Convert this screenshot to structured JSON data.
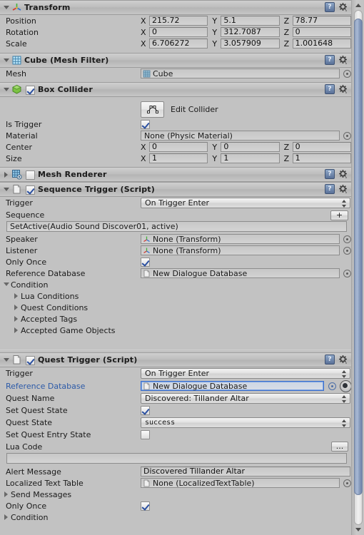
{
  "components": [
    {
      "id": "transform",
      "title": "Transform",
      "icon": "transform-axis-icon",
      "expanded": true,
      "has_enable_checkbox": false,
      "vectors": [
        {
          "label": "Position",
          "x": "215.72",
          "y": "5.1",
          "z": "78.77"
        },
        {
          "label": "Rotation",
          "x": "0",
          "y": "312.7087",
          "z": "0"
        },
        {
          "label": "Scale",
          "x": "6.706272",
          "y": "3.057909",
          "z": "1.001648"
        }
      ]
    },
    {
      "id": "mesh-filter",
      "title": "Cube (Mesh Filter)",
      "icon": "mesh-filter-icon",
      "expanded": true,
      "has_enable_checkbox": false,
      "mesh_label": "Mesh",
      "mesh_value": "Cube"
    },
    {
      "id": "box-collider",
      "title": "Box Collider",
      "icon": "box-collider-icon",
      "expanded": true,
      "has_enable_checkbox": true,
      "enabled": true,
      "edit_collider_label": "Edit Collider",
      "is_trigger_label": "Is Trigger",
      "is_trigger_value": true,
      "material_label": "Material",
      "material_value": "None (Physic Material)",
      "center": {
        "label": "Center",
        "x": "0",
        "y": "0",
        "z": "0"
      },
      "size": {
        "label": "Size",
        "x": "1",
        "y": "1",
        "z": "1"
      }
    },
    {
      "id": "mesh-renderer",
      "title": "Mesh Renderer",
      "icon": "mesh-renderer-icon",
      "expanded": false,
      "has_enable_checkbox": true,
      "enabled": false
    },
    {
      "id": "sequence-trigger",
      "title": "Sequence Trigger (Script)",
      "icon": "script-icon",
      "expanded": true,
      "has_enable_checkbox": true,
      "enabled": true,
      "trigger_label": "Trigger",
      "trigger_value": "On Trigger Enter",
      "sequence_label": "Sequence",
      "sequence_add_label": "+",
      "sequence_value": "SetActive(Audio Sound Discover01, active)",
      "speaker_label": "Speaker",
      "speaker_value": "None (Transform)",
      "listener_label": "Listener",
      "listener_value": "None (Transform)",
      "only_once_label": "Only Once",
      "only_once_value": true,
      "reference_database_label": "Reference Database",
      "reference_database_value": "New Dialogue Database",
      "condition_label": "Condition",
      "condition_items": [
        "Lua Conditions",
        "Quest Conditions",
        "Accepted Tags",
        "Accepted Game Objects"
      ]
    },
    {
      "id": "quest-trigger",
      "title": "Quest Trigger (Script)",
      "icon": "script-icon",
      "expanded": true,
      "has_enable_checkbox": true,
      "enabled": true,
      "trigger_label": "Trigger",
      "trigger_value": "On Trigger Enter",
      "reference_database_label": "Reference Database",
      "reference_database_value": "New Dialogue Database",
      "reference_database_focused": true,
      "quest_name_label": "Quest Name",
      "quest_name_value": "Discovered: Tillander Altar",
      "set_quest_state_label": "Set Quest State",
      "set_quest_state_value": true,
      "quest_state_label": "Quest State",
      "quest_state_value": "success",
      "set_quest_entry_state_label": "Set Quest Entry State",
      "set_quest_entry_state_value": false,
      "lua_code_label": "Lua Code",
      "lua_code_button_label": "...",
      "lua_code_value": "",
      "alert_message_label": "Alert Message",
      "alert_message_value": "Discovered Tillander Altar",
      "localized_text_table_label": "Localized Text Table",
      "localized_text_table_value": "None (LocalizedTextTable)",
      "send_messages_label": "Send Messages",
      "only_once_label": "Only Once",
      "only_once_value": true,
      "condition_label": "Condition"
    }
  ],
  "axis_labels": {
    "x": "X",
    "y": "Y",
    "z": "Z"
  },
  "header_icons": {
    "help": "?",
    "gear": "settings"
  },
  "colors": {
    "panel_bg": "#c2c2c2",
    "focus_blue": "#2c5aa8",
    "check_blue": "#2a4fa0",
    "scrollbar_thumb": "#8fa0bd"
  },
  "scrollbar": {
    "up_arrow": "▲",
    "down_arrow": "▼"
  }
}
